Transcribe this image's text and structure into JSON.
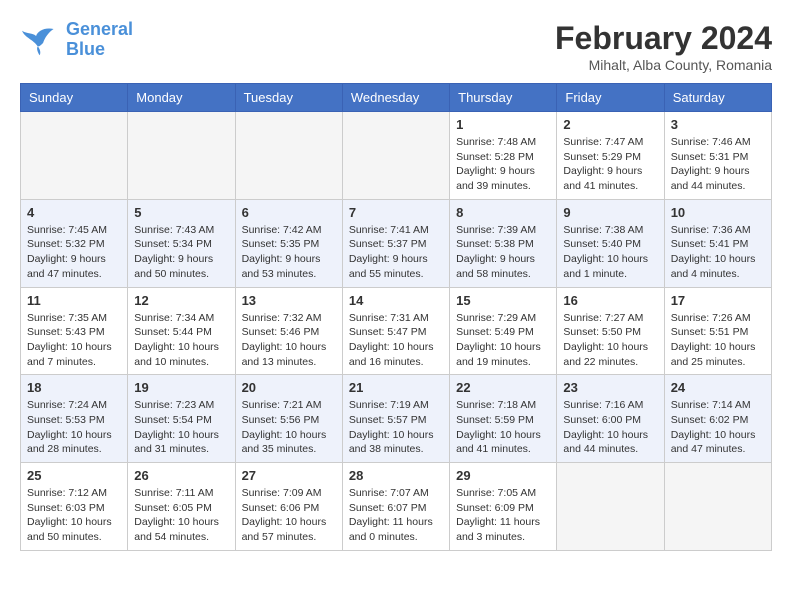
{
  "header": {
    "logo_line1": "General",
    "logo_line2": "Blue",
    "month_year": "February 2024",
    "location": "Mihalt, Alba County, Romania"
  },
  "weekdays": [
    "Sunday",
    "Monday",
    "Tuesday",
    "Wednesday",
    "Thursday",
    "Friday",
    "Saturday"
  ],
  "weeks": [
    [
      {
        "day": "",
        "info": ""
      },
      {
        "day": "",
        "info": ""
      },
      {
        "day": "",
        "info": ""
      },
      {
        "day": "",
        "info": ""
      },
      {
        "day": "1",
        "info": "Sunrise: 7:48 AM\nSunset: 5:28 PM\nDaylight: 9 hours\nand 39 minutes."
      },
      {
        "day": "2",
        "info": "Sunrise: 7:47 AM\nSunset: 5:29 PM\nDaylight: 9 hours\nand 41 minutes."
      },
      {
        "day": "3",
        "info": "Sunrise: 7:46 AM\nSunset: 5:31 PM\nDaylight: 9 hours\nand 44 minutes."
      }
    ],
    [
      {
        "day": "4",
        "info": "Sunrise: 7:45 AM\nSunset: 5:32 PM\nDaylight: 9 hours\nand 47 minutes."
      },
      {
        "day": "5",
        "info": "Sunrise: 7:43 AM\nSunset: 5:34 PM\nDaylight: 9 hours\nand 50 minutes."
      },
      {
        "day": "6",
        "info": "Sunrise: 7:42 AM\nSunset: 5:35 PM\nDaylight: 9 hours\nand 53 minutes."
      },
      {
        "day": "7",
        "info": "Sunrise: 7:41 AM\nSunset: 5:37 PM\nDaylight: 9 hours\nand 55 minutes."
      },
      {
        "day": "8",
        "info": "Sunrise: 7:39 AM\nSunset: 5:38 PM\nDaylight: 9 hours\nand 58 minutes."
      },
      {
        "day": "9",
        "info": "Sunrise: 7:38 AM\nSunset: 5:40 PM\nDaylight: 10 hours\nand 1 minute."
      },
      {
        "day": "10",
        "info": "Sunrise: 7:36 AM\nSunset: 5:41 PM\nDaylight: 10 hours\nand 4 minutes."
      }
    ],
    [
      {
        "day": "11",
        "info": "Sunrise: 7:35 AM\nSunset: 5:43 PM\nDaylight: 10 hours\nand 7 minutes."
      },
      {
        "day": "12",
        "info": "Sunrise: 7:34 AM\nSunset: 5:44 PM\nDaylight: 10 hours\nand 10 minutes."
      },
      {
        "day": "13",
        "info": "Sunrise: 7:32 AM\nSunset: 5:46 PM\nDaylight: 10 hours\nand 13 minutes."
      },
      {
        "day": "14",
        "info": "Sunrise: 7:31 AM\nSunset: 5:47 PM\nDaylight: 10 hours\nand 16 minutes."
      },
      {
        "day": "15",
        "info": "Sunrise: 7:29 AM\nSunset: 5:49 PM\nDaylight: 10 hours\nand 19 minutes."
      },
      {
        "day": "16",
        "info": "Sunrise: 7:27 AM\nSunset: 5:50 PM\nDaylight: 10 hours\nand 22 minutes."
      },
      {
        "day": "17",
        "info": "Sunrise: 7:26 AM\nSunset: 5:51 PM\nDaylight: 10 hours\nand 25 minutes."
      }
    ],
    [
      {
        "day": "18",
        "info": "Sunrise: 7:24 AM\nSunset: 5:53 PM\nDaylight: 10 hours\nand 28 minutes."
      },
      {
        "day": "19",
        "info": "Sunrise: 7:23 AM\nSunset: 5:54 PM\nDaylight: 10 hours\nand 31 minutes."
      },
      {
        "day": "20",
        "info": "Sunrise: 7:21 AM\nSunset: 5:56 PM\nDaylight: 10 hours\nand 35 minutes."
      },
      {
        "day": "21",
        "info": "Sunrise: 7:19 AM\nSunset: 5:57 PM\nDaylight: 10 hours\nand 38 minutes."
      },
      {
        "day": "22",
        "info": "Sunrise: 7:18 AM\nSunset: 5:59 PM\nDaylight: 10 hours\nand 41 minutes."
      },
      {
        "day": "23",
        "info": "Sunrise: 7:16 AM\nSunset: 6:00 PM\nDaylight: 10 hours\nand 44 minutes."
      },
      {
        "day": "24",
        "info": "Sunrise: 7:14 AM\nSunset: 6:02 PM\nDaylight: 10 hours\nand 47 minutes."
      }
    ],
    [
      {
        "day": "25",
        "info": "Sunrise: 7:12 AM\nSunset: 6:03 PM\nDaylight: 10 hours\nand 50 minutes."
      },
      {
        "day": "26",
        "info": "Sunrise: 7:11 AM\nSunset: 6:05 PM\nDaylight: 10 hours\nand 54 minutes."
      },
      {
        "day": "27",
        "info": "Sunrise: 7:09 AM\nSunset: 6:06 PM\nDaylight: 10 hours\nand 57 minutes."
      },
      {
        "day": "28",
        "info": "Sunrise: 7:07 AM\nSunset: 6:07 PM\nDaylight: 11 hours\nand 0 minutes."
      },
      {
        "day": "29",
        "info": "Sunrise: 7:05 AM\nSunset: 6:09 PM\nDaylight: 11 hours\nand 3 minutes."
      },
      {
        "day": "",
        "info": ""
      },
      {
        "day": "",
        "info": ""
      }
    ]
  ]
}
